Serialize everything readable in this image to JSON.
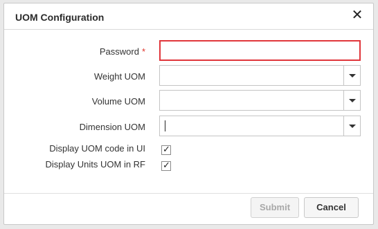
{
  "dialog": {
    "title": "UOM Configuration",
    "close_glyph": "✕",
    "fields": {
      "password": {
        "label": "Password",
        "required_mark": "*",
        "value": ""
      },
      "weight_uom": {
        "label": "Weight UOM",
        "value": ""
      },
      "volume_uom": {
        "label": "Volume UOM",
        "value": ""
      },
      "dimension_uom": {
        "label": "Dimension UOM",
        "value": ""
      }
    },
    "checkboxes": {
      "display_uom_code": {
        "label": "Display UOM code in UI",
        "checked": true,
        "mark": "✓"
      },
      "display_units_uom_rf": {
        "label": "Display Units UOM in RF",
        "checked": true,
        "mark": "✓"
      }
    },
    "buttons": {
      "submit": "Submit",
      "cancel": "Cancel"
    },
    "colors": {
      "required": "#e0352b",
      "password_border": "#e0353a",
      "disabled_text": "#a8a8a8"
    }
  }
}
